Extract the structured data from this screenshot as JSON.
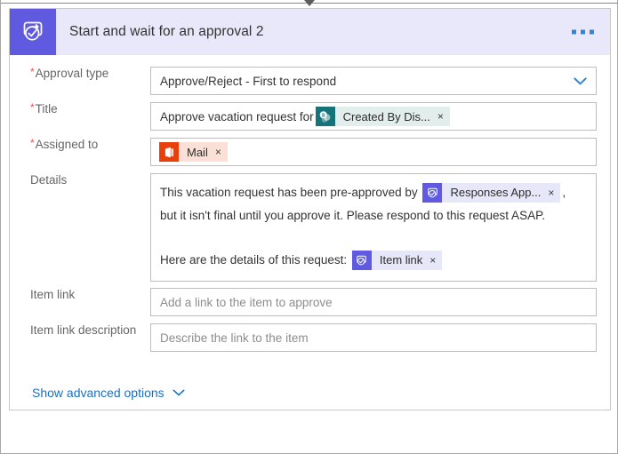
{
  "card": {
    "title": "Start and wait for an approval 2",
    "icon": "approval-icon",
    "header_bg": "#e8e8fa",
    "icon_bg": "#605ae0",
    "menu_label": "More commands"
  },
  "fields": {
    "approval_type": {
      "label": "Approval type",
      "required": true,
      "required_marker": "*",
      "value": "Approve/Reject - First to respond",
      "chevron": "chevron-down-icon"
    },
    "title": {
      "label": "Title",
      "required": true,
      "required_marker": "*",
      "text_prefix": "Approve vacation request for",
      "chip": {
        "icon": "sharepoint-icon",
        "label": "Created By Dis...",
        "remove": "×",
        "icon_color": "#15737a",
        "body_color": "#e2eeec"
      }
    },
    "assigned_to": {
      "label": "Assigned to",
      "required": true,
      "required_marker": "*",
      "chip": {
        "icon": "office365-outlook-icon",
        "label": "Mail",
        "remove": "×",
        "icon_color": "#e8400c",
        "body_color": "#fbe0d8"
      }
    },
    "details": {
      "label": "Details",
      "required": false,
      "line1_prefix": "This vacation request has been pre-approved by",
      "line1_suffix": ",",
      "line1_chip": {
        "icon": "approval-icon",
        "label": "Responses App...",
        "remove": "×",
        "icon_color": "#605ae0",
        "body_color": "#e7e7fa"
      },
      "line2": "but it isn't final until you approve it. Please respond to this request ASAP.",
      "line3_prefix": "Here are the details of this request:",
      "line3_chip": {
        "icon": "approval-icon",
        "label": "Item link",
        "remove": "×",
        "icon_color": "#605ae0",
        "body_color": "#e7e7fa"
      }
    },
    "item_link": {
      "label": "Item link",
      "required": false,
      "value": "",
      "placeholder": "Add a link to the item to approve"
    },
    "item_link_description": {
      "label": "Item link description",
      "required": false,
      "value": "",
      "placeholder": "Describe the link to the item"
    }
  },
  "advanced": {
    "label": "Show advanced options",
    "chevron": "chevron-down-icon"
  },
  "colors": {
    "accent_purple": "#605ae0",
    "link_blue": "#1a6fc4",
    "chevron_blue": "#2b88d8",
    "required_red": "#e8554e",
    "label_gray": "#666666",
    "border_gray": "#bdbdbd"
  }
}
